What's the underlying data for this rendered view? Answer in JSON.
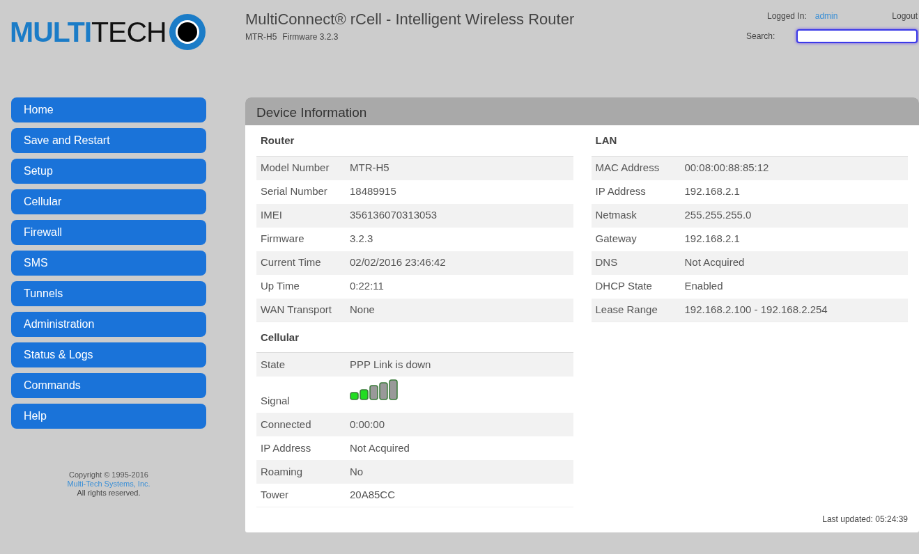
{
  "logo": {
    "part_1": "MULTI",
    "part_2": "TECH"
  },
  "header": {
    "title": "MultiConnect® rCell - Intelligent Wireless Router",
    "model": "MTR-H5",
    "firmware": "Firmware 3.2.3"
  },
  "user": {
    "label": "Logged In:",
    "name": "admin",
    "logout": "Logout",
    "search_label": "Search:"
  },
  "nav": [
    {
      "label": "Home"
    },
    {
      "label": "Save and Restart"
    },
    {
      "label": "Setup"
    },
    {
      "label": "Cellular"
    },
    {
      "label": "Firewall"
    },
    {
      "label": "SMS"
    },
    {
      "label": "Tunnels"
    },
    {
      "label": "Administration"
    },
    {
      "label": "Status & Logs"
    },
    {
      "label": "Commands"
    },
    {
      "label": "Help"
    }
  ],
  "footer": {
    "copyright": "Copyright © 1995-2016",
    "company": "Multi-Tech Systems, Inc.",
    "rights": "All rights reserved."
  },
  "panel": {
    "title": "Device Information",
    "last_updated": "Last updated: 05:24:39",
    "columns": [
      [
        {
          "heading": "Router",
          "rows": [
            {
              "kind": "text",
              "label": "Model Number",
              "value": "MTR-H5"
            },
            {
              "kind": "text",
              "label": "Serial Number",
              "value": "18489915"
            },
            {
              "kind": "text",
              "label": "IMEI",
              "value": "356136070313053"
            },
            {
              "kind": "text",
              "label": "Firmware",
              "value": "3.2.3"
            },
            {
              "kind": "text",
              "label": "Current Time",
              "value": "02/02/2016 23:46:42"
            },
            {
              "kind": "text",
              "label": "Up Time",
              "value": "0:22:11"
            },
            {
              "kind": "text",
              "label": "WAN Transport",
              "value": "None"
            }
          ]
        },
        {
          "heading": "Cellular",
          "rows": [
            {
              "kind": "text",
              "label": "State",
              "value": "PPP Link is down"
            },
            {
              "kind": "signal",
              "label": "Signal"
            },
            {
              "kind": "text",
              "label": "Connected",
              "value": "0:00:00"
            },
            {
              "kind": "text",
              "label": "IP Address",
              "value": "Not Acquired"
            },
            {
              "kind": "text",
              "label": "Roaming",
              "value": "No"
            },
            {
              "kind": "text",
              "label": "Tower",
              "value": "20A85CC"
            }
          ]
        }
      ],
      [
        {
          "heading": "LAN",
          "rows": [
            {
              "kind": "text",
              "label": "MAC Address",
              "value": "00:08:00:88:85:12"
            },
            {
              "kind": "text",
              "label": "IP Address",
              "value": "192.168.2.1"
            },
            {
              "kind": "text",
              "label": "Netmask",
              "value": "255.255.255.0"
            },
            {
              "kind": "text",
              "label": "Gateway",
              "value": "192.168.2.1"
            },
            {
              "kind": "text",
              "label": "DNS",
              "value": "Not Acquired"
            },
            {
              "kind": "text",
              "label": "DHCP State",
              "value": "Enabled"
            },
            {
              "kind": "text",
              "label": "Lease Range",
              "value": "192.168.2.100 - 192.168.2.254"
            }
          ]
        }
      ]
    ]
  }
}
